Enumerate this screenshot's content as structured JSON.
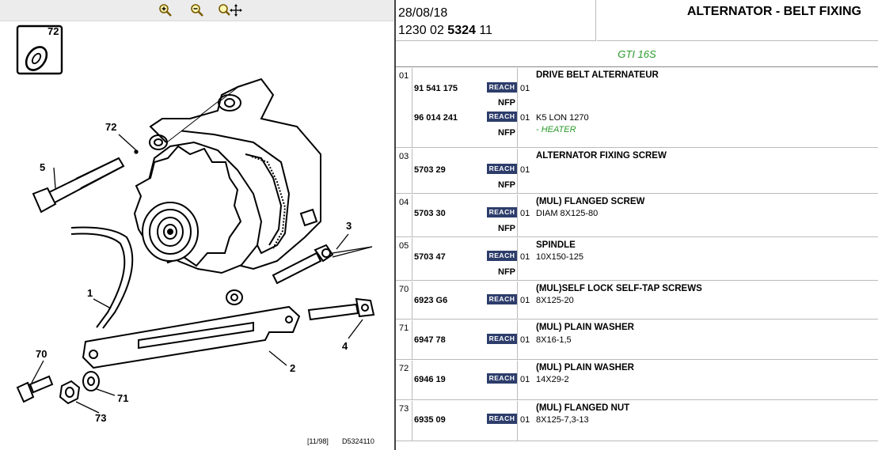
{
  "toolbar": {
    "zoom_in_icon": "zoom-in-icon",
    "zoom_out_icon": "zoom-out-icon",
    "zoom_pan_icon": "zoom-pan-icon"
  },
  "diagram": {
    "callouts": [
      "72",
      "5",
      "72",
      "3",
      "1",
      "4",
      "70",
      "2",
      "71",
      "73"
    ],
    "footer_date": "[11/98]",
    "footer_ref": "D5324110"
  },
  "header": {
    "date": "28/08/18",
    "ref_prefix": "1230 02",
    "ref_bold": "5324",
    "ref_suffix": "11",
    "title": "ALTERNATOR - BELT FIXING"
  },
  "model": "GTI 16S",
  "reach_label": "REACH",
  "groups": [
    {
      "num": "01",
      "parts": [
        {
          "pn": "91 541 175",
          "qty": "01",
          "nfp": "NFP",
          "title": "DRIVE BELT ALTERNATEUR",
          "spec": "",
          "note": ""
        },
        {
          "pn": "96 014 241",
          "qty": "01",
          "nfp": "NFP",
          "title": "",
          "spec": "K5 LON 1270",
          "note": "- HEATER"
        }
      ]
    },
    {
      "num": "03",
      "parts": [
        {
          "pn": "5703 29",
          "qty": "01",
          "nfp": "NFP",
          "title": "ALTERNATOR FIXING SCREW",
          "spec": "",
          "note": ""
        }
      ]
    },
    {
      "num": "04",
      "parts": [
        {
          "pn": "5703 30",
          "qty": "01",
          "nfp": "NFP",
          "title": "(MUL) FLANGED SCREW",
          "spec": "DIAM 8X125-80",
          "note": ""
        }
      ]
    },
    {
      "num": "05",
      "parts": [
        {
          "pn": "5703 47",
          "qty": "01",
          "nfp": "NFP",
          "title": "SPINDLE",
          "spec": "10X150-125",
          "note": ""
        }
      ]
    },
    {
      "num": "70",
      "parts": [
        {
          "pn": "6923 G6",
          "qty": "01",
          "nfp": "",
          "title": "(MUL)SELF LOCK SELF-TAP SCREWS",
          "spec": "8X125-20",
          "note": ""
        }
      ]
    },
    {
      "num": "71",
      "parts": [
        {
          "pn": "6947 78",
          "qty": "01",
          "nfp": "",
          "title": "(MUL) PLAIN WASHER",
          "spec": "8X16-1,5",
          "note": ""
        }
      ]
    },
    {
      "num": "72",
      "parts": [
        {
          "pn": "6946 19",
          "qty": "01",
          "nfp": "",
          "title": "(MUL) PLAIN WASHER",
          "spec": "14X29-2",
          "note": ""
        }
      ]
    },
    {
      "num": "73",
      "parts": [
        {
          "pn": "6935 09",
          "qty": "01",
          "nfp": "",
          "title": "(MUL) FLANGED NUT",
          "spec": "8X125-7,3-13",
          "note": ""
        }
      ]
    }
  ]
}
